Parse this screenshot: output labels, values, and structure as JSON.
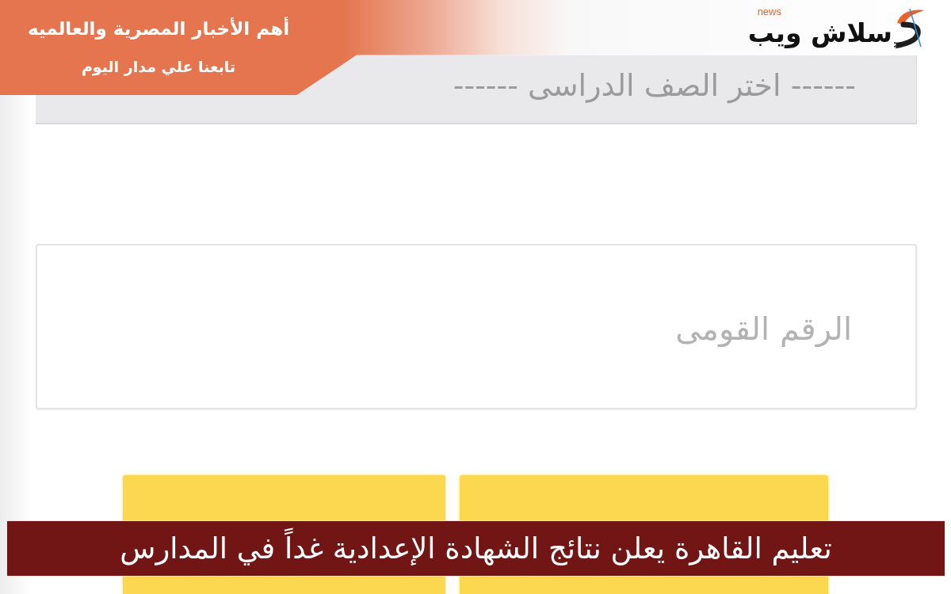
{
  "banner": {
    "title": "أهم الأخبار المصرية والعالميه",
    "subtitle": "تابعنا علي مدار اليوم"
  },
  "logo": {
    "name": "سلاش ويب",
    "tag": "news"
  },
  "form": {
    "grade_select": {
      "placeholder": "------ اختر الصف الدراسى ------"
    },
    "national_id": {
      "placeholder": "الرقم القومى"
    }
  },
  "caption": "تعليم القاهرة يعلن نتائج الشهادة الإعدادية غداً في المدارس"
}
